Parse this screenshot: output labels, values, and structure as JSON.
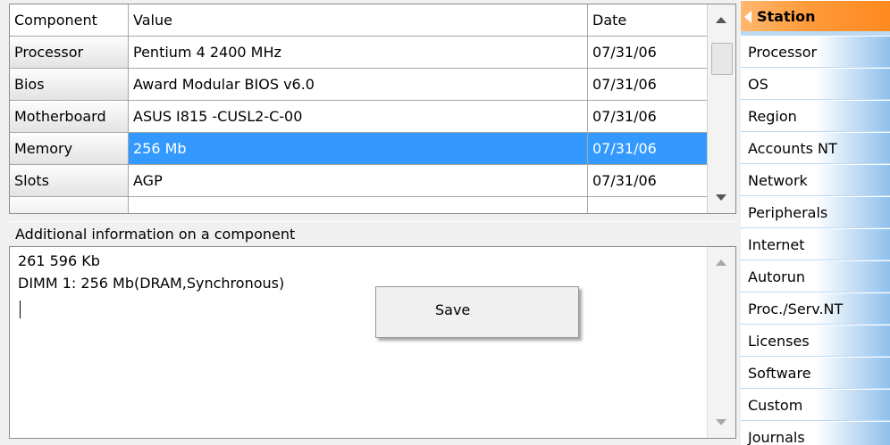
{
  "grid": {
    "headers": {
      "component": "Component",
      "value": "Value",
      "date": "Date"
    },
    "rows": [
      {
        "component": "Processor",
        "value": "Pentium 4 2400 MHz",
        "date": "07/31/06"
      },
      {
        "component": "Bios",
        "value": "Award Modular BIOS v6.0",
        "date": "07/31/06"
      },
      {
        "component": "Motherboard",
        "value": "ASUS I815 -CUSL2-C-00",
        "date": "07/31/06"
      },
      {
        "component": "Memory",
        "value": "256 Mb",
        "date": "07/31/06",
        "selected": true
      },
      {
        "component": "Slots",
        "value": "AGP",
        "date": "07/31/06"
      }
    ]
  },
  "additional_info": {
    "caption": "Additional information on a component",
    "lines": [
      "261 596 Kb",
      "DIMM 1: 256 Mb(DRAM,Synchronous)"
    ]
  },
  "context_menu": {
    "save_label": "Save"
  },
  "nav": {
    "items": [
      {
        "label": "Station",
        "active": true
      },
      {
        "label": "Processor"
      },
      {
        "label": "OS"
      },
      {
        "label": "Region"
      },
      {
        "label": "Accounts NT"
      },
      {
        "label": "Network"
      },
      {
        "label": "Peripherals"
      },
      {
        "label": "Internet"
      },
      {
        "label": "Autorun"
      },
      {
        "label": "Proc./Serv.NT"
      },
      {
        "label": "Licenses"
      },
      {
        "label": "Software"
      },
      {
        "label": "Custom"
      },
      {
        "label": "Journals"
      }
    ]
  },
  "colors": {
    "selection": "#3399ff",
    "nav_active": "#ff9a3a",
    "nav_gradient_end": "#8fc0ec"
  },
  "icons": {
    "scroll_up": "arrow-up-icon",
    "scroll_down": "arrow-down-icon",
    "active_marker": "triangle-left-icon"
  }
}
